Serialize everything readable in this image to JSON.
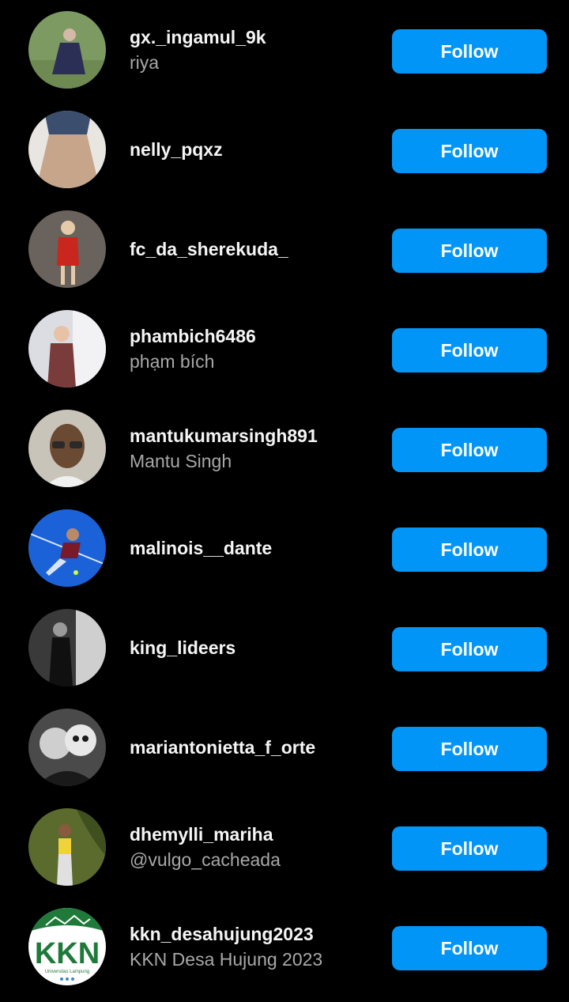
{
  "theme": {
    "background": "#000000",
    "button_color": "#0095f6",
    "username_color": "#f5f5f5",
    "secondary_color": "#a8a8a8"
  },
  "follow_label": "Follow",
  "users": [
    {
      "username": "gx._ingamul_9k",
      "full_name": "riya",
      "avatar": {
        "bg": "#7d9a63",
        "fg": "#2c2f55",
        "accent": "#d4b9a8"
      }
    },
    {
      "username": "nelly_pqxz",
      "full_name": "",
      "avatar": {
        "bg": "#e9e6e2",
        "fg": "#c7a58b",
        "accent": "#3c4e6e"
      }
    },
    {
      "username": "fc_da_sherekuda_",
      "full_name": "",
      "avatar": {
        "bg": "#6a625c",
        "fg": "#c9261e",
        "accent": "#e6c9a8"
      }
    },
    {
      "username": "phambich6486",
      "full_name": "phạm bích",
      "avatar": {
        "bg": "#dcdde3",
        "fg": "#7a3b3b",
        "accent": "#f2f2f5"
      }
    },
    {
      "username": "mantukumarsingh891",
      "full_name": "Mantu Singh",
      "avatar": {
        "bg": "#c9c4ba",
        "fg": "#6b4a33",
        "accent": "#2a2a2a"
      }
    },
    {
      "username": "malinois__dante",
      "full_name": "",
      "avatar": {
        "bg": "#1b62d9",
        "fg": "#d8e4f5",
        "accent": "#7a1a28"
      }
    },
    {
      "username": "king_lideers",
      "full_name": "",
      "avatar": {
        "bg": "#3a3a3a",
        "fg": "#101010",
        "accent": "#cfcfcf"
      }
    },
    {
      "username": "mariantonietta_f_orte",
      "full_name": "",
      "avatar": {
        "bg": "#4a4a4a",
        "fg": "#e8e8e8",
        "accent": "#1a1a1a"
      }
    },
    {
      "username": "dhemylli_mariha",
      "full_name": "@vulgo_cacheada",
      "avatar": {
        "bg": "#5b6b2e",
        "fg": "#f0d33a",
        "accent": "#8a5a3c"
      }
    },
    {
      "username": "kkn_desahujung2023",
      "full_name": "KKN Desa Hujung 2023",
      "avatar": {
        "bg": "#ffffff",
        "fg": "#1f7a3a",
        "accent": "#3a86c8",
        "logo_text": "KKN",
        "logo_subtext": "Universitas Lampung"
      }
    }
  ]
}
